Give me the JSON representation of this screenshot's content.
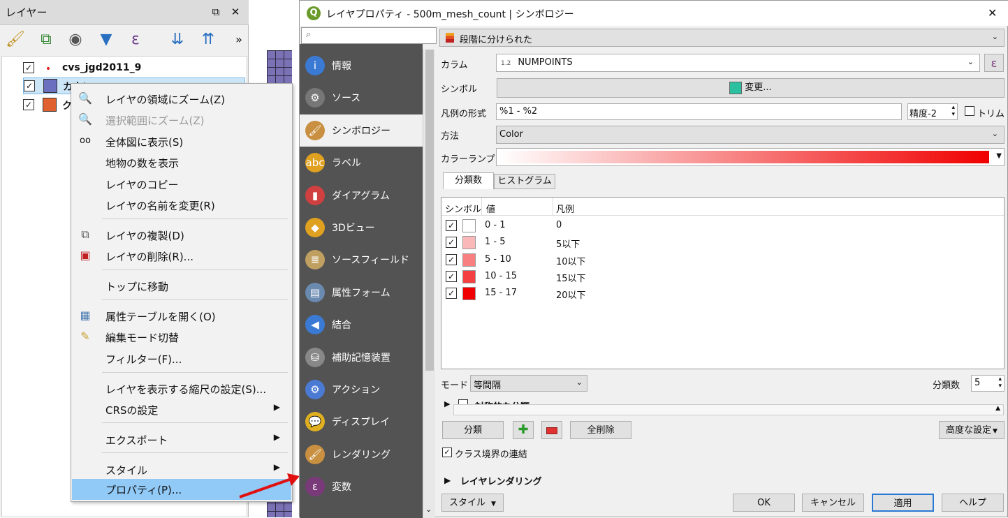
{
  "layers_panel": {
    "title": "レイヤー",
    "float_icon": "⧉",
    "close_icon": "✕",
    "more": "»",
    "layers": [
      {
        "name": "cvs_jgd2011_9",
        "color": "#e02020"
      },
      {
        "name": "カウン",
        "color": "#6a6fc0"
      },
      {
        "name": "ク",
        "color": "#e06030"
      }
    ]
  },
  "context_menu": {
    "items": [
      "レイヤの領域にズーム(Z)",
      "選択範囲にズーム(Z)",
      "全体図に表示(S)",
      "地物の数を表示",
      "レイヤのコピー",
      "レイヤの名前を変更(R)",
      "レイヤの複製(D)",
      "レイヤの削除(R)...",
      "トップに移動",
      "属性テーブルを開く(O)",
      "編集モード切替",
      "フィルター(F)...",
      "レイヤを表示する縮尺の設定(S)...",
      "CRSの設定",
      "エクスポート",
      "スタイル",
      "プロパティ(P)..."
    ]
  },
  "dialog": {
    "title": "レイヤプロパティ - 500m_mesh_count | シンボロジー",
    "app_icon": "Q",
    "close": "✕",
    "nav": [
      "情報",
      "ソース",
      "シンボロジー",
      "ラベル",
      "ダイアグラム",
      "3Dビュー",
      "ソースフィールド",
      "属性フォーム",
      "結合",
      "補助記憶装置",
      "アクション",
      "ディスプレイ",
      "レンダリング",
      "変数"
    ],
    "nav_icons": [
      "i",
      "⚙",
      "🖌",
      "abc",
      "▮",
      "◆",
      "≣",
      "▤",
      "◀",
      "⛁",
      "⚙",
      "💬",
      "🖌",
      "ε"
    ],
    "renderer": "段階に分けられた",
    "column_label": "カラム",
    "column_type": "1.2",
    "column_value": "NUMPOINTS",
    "expr_icon": "ε",
    "symbol_label": "シンボル",
    "symbol_button": "変更...",
    "legend_label": "凡例の形式",
    "legend_format": "%1 - %2",
    "precision": "精度-2",
    "trim": "トリム",
    "method_label": "方法",
    "method_value": "Color",
    "ramp_label": "カラーランプ",
    "tabs": [
      "分類数",
      "ヒストグラム"
    ],
    "table_headers": [
      "シンボル",
      "値",
      "凡例"
    ],
    "classes": [
      {
        "value": "0 - 1",
        "legend": "0",
        "color": "#ffffff"
      },
      {
        "value": "1 - 5",
        "legend": "5以下",
        "color": "#fbb8b8"
      },
      {
        "value": "5 - 10",
        "legend": "10以下",
        "color": "#f88080"
      },
      {
        "value": "10 - 15",
        "legend": "15以下",
        "color": "#f44040"
      },
      {
        "value": "15 - 17",
        "legend": "20以下",
        "color": "#f00000"
      }
    ],
    "mode_label": "モード",
    "mode_value": "等間隔",
    "classes_count_label": "分類数",
    "classes_count": "5",
    "symmetric_label": "対称的な分類",
    "classify_button": "分類",
    "delete_all_button": "全削除",
    "advanced_button": "高度な設定",
    "link_label": "クラス境界の連結",
    "layer_rendering": "レイヤレンダリング",
    "style_button": "スタイル",
    "ok": "OK",
    "cancel": "キャンセル",
    "apply": "適用",
    "help": "ヘルプ"
  }
}
